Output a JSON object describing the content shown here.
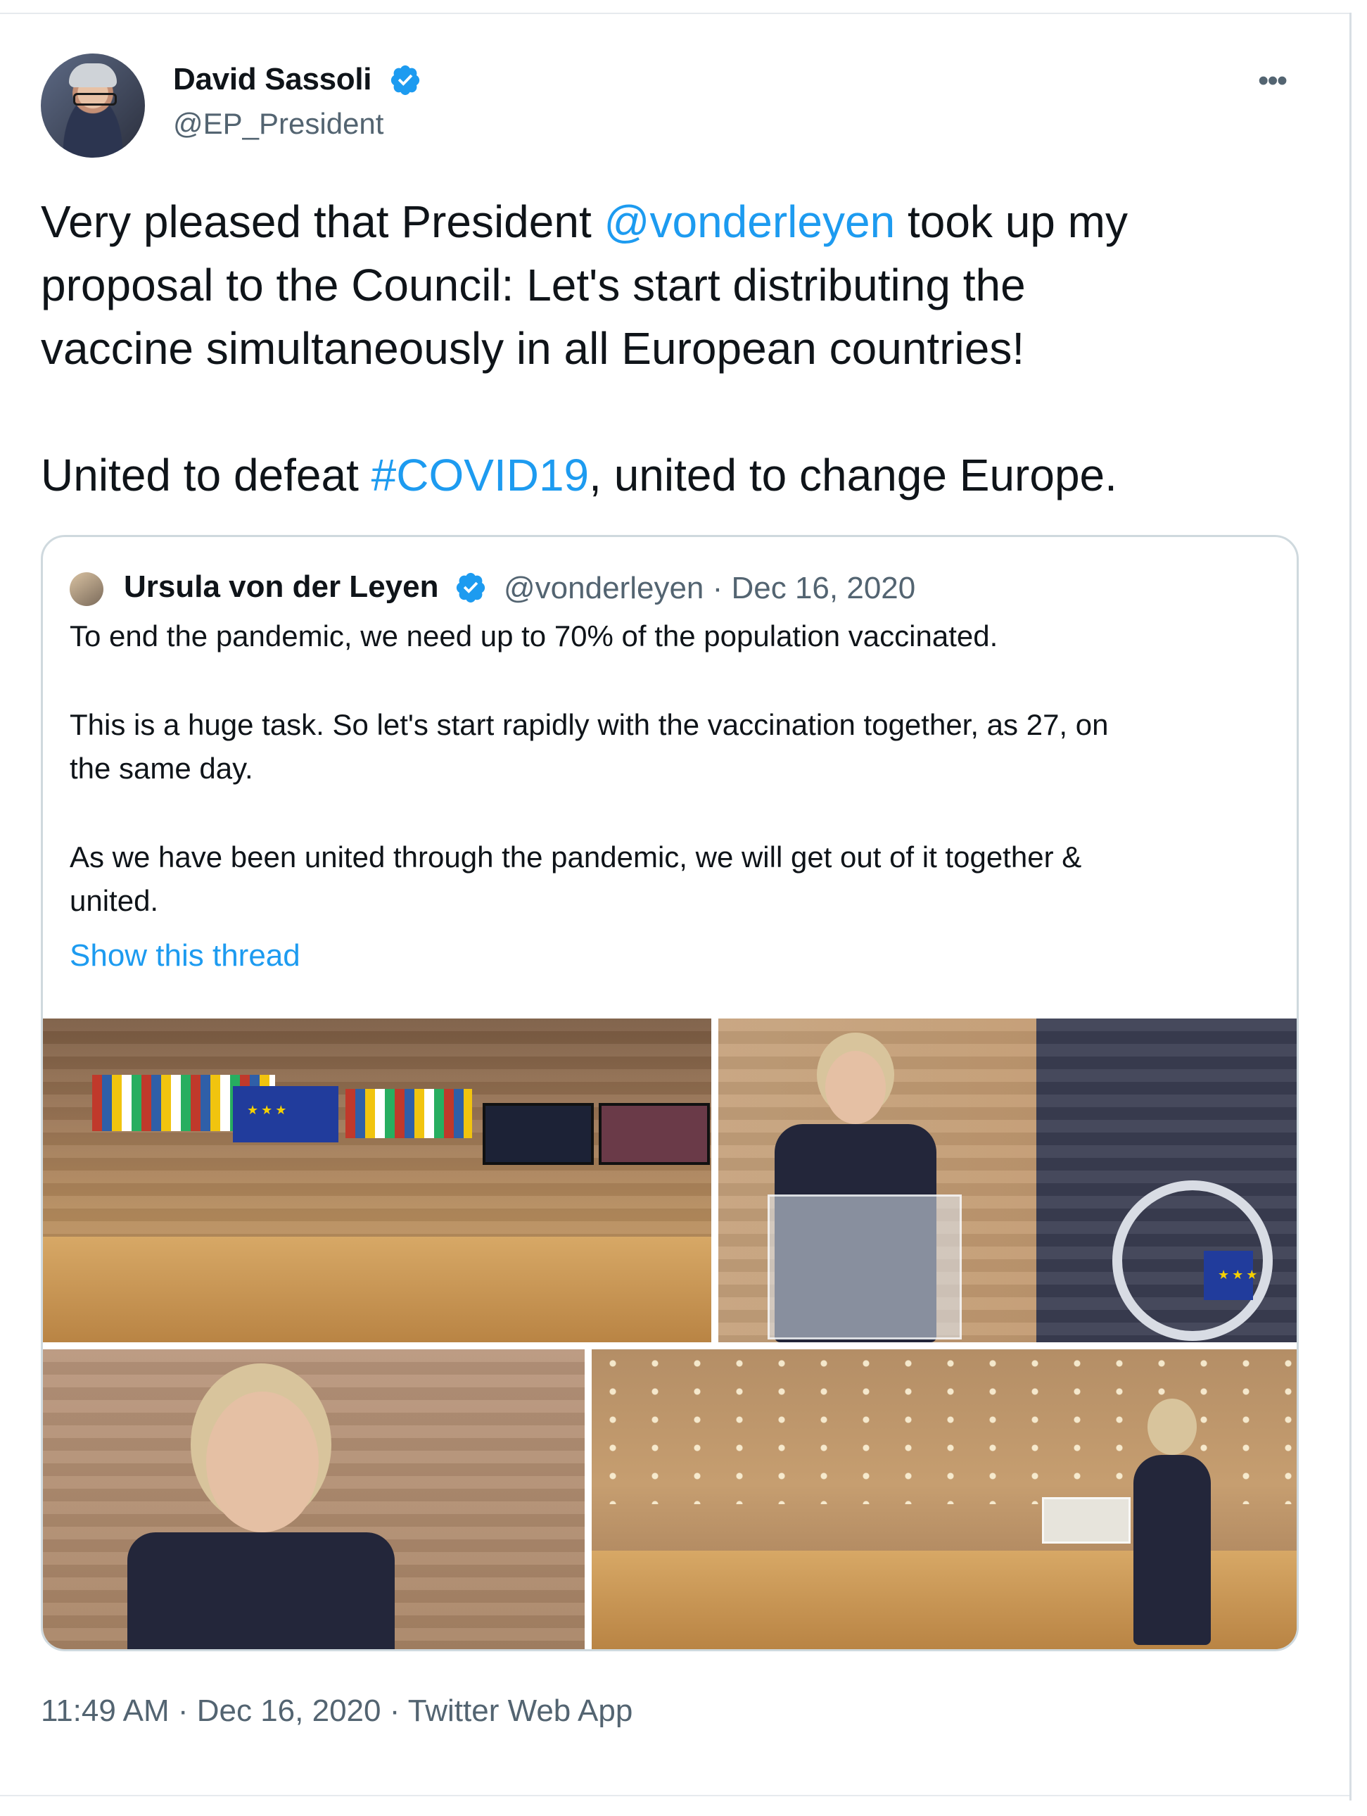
{
  "author": {
    "name": "David Sassoli",
    "handle": "@EP_President",
    "verified": true
  },
  "tweet": {
    "line1_pre": "Very pleased that President ",
    "mention": "@vonderleyen",
    "line1_post": " took up my",
    "line2": "proposal to the Council: Let's start distributing the",
    "line3": "vaccine simultaneously in all European countries!",
    "line4_pre": "United to defeat ",
    "hashtag": "#COVID19",
    "line4_post": ", united to change Europe."
  },
  "quote": {
    "name": "Ursula von der Leyen",
    "verified": true,
    "handle_date": "@vonderleyen · Dec 16, 2020",
    "p1": "To end the pandemic, we need up to 70% of the population vaccinated.",
    "p2_l1": "This is a huge task. So let's start rapidly with the vaccination together, as 27, on",
    "p2_l2": "the same day.",
    "p3_l1": "As we have been united through the pandemic, we will get out of it together &",
    "p3_l2": "united.",
    "show_thread": "Show this thread"
  },
  "meta": {
    "timestamp": "11:49 AM · Dec 16, 2020 · Twitter Web App"
  },
  "icons": {
    "more": "more-icon",
    "verified": "verified-badge-icon"
  },
  "colors": {
    "link": "#1d9bf0",
    "secondary_text": "#536471",
    "border": "#cfd9de"
  }
}
